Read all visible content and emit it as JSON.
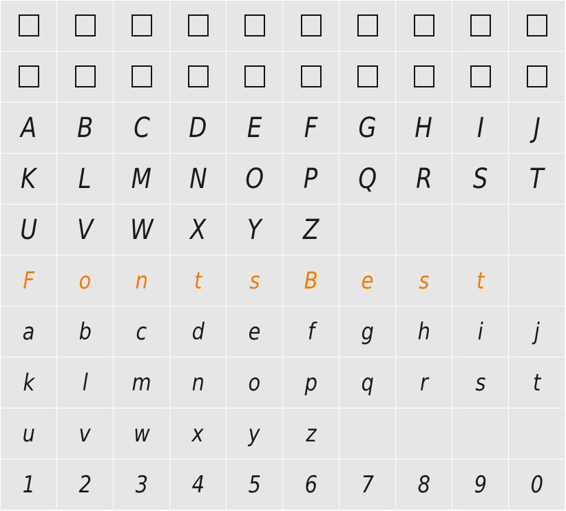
{
  "rows": [
    {
      "type": "boxes",
      "count": 10
    },
    {
      "type": "boxes",
      "count": 10
    },
    {
      "type": "upper",
      "glyphs": [
        "A",
        "B",
        "C",
        "D",
        "E",
        "F",
        "G",
        "H",
        "I",
        "J"
      ]
    },
    {
      "type": "upper",
      "glyphs": [
        "K",
        "L",
        "M",
        "N",
        "O",
        "P",
        "Q",
        "R",
        "S",
        "T"
      ]
    },
    {
      "type": "upper",
      "glyphs": [
        "U",
        "V",
        "W",
        "X",
        "Y",
        "Z",
        "",
        "",
        "",
        ""
      ]
    },
    {
      "type": "accent",
      "glyphs": [
        "F",
        "o",
        "n",
        "t",
        "s",
        "B",
        "e",
        "s",
        "t",
        ""
      ]
    },
    {
      "type": "lower",
      "glyphs": [
        "a",
        "b",
        "c",
        "d",
        "e",
        "f",
        "g",
        "h",
        "i",
        "j"
      ]
    },
    {
      "type": "lower",
      "glyphs": [
        "k",
        "l",
        "m",
        "n",
        "o",
        "p",
        "q",
        "r",
        "s",
        "t"
      ]
    },
    {
      "type": "lower",
      "glyphs": [
        "u",
        "v",
        "w",
        "x",
        "y",
        "z",
        "",
        "",
        "",
        ""
      ]
    },
    {
      "type": "lower",
      "glyphs": [
        "1",
        "2",
        "3",
        "4",
        "5",
        "6",
        "7",
        "8",
        "9",
        "0"
      ]
    }
  ],
  "colors": {
    "cell_background": "#e6e6e6",
    "grid_lines": "#ffffff",
    "glyph": "#1a1a1a",
    "accent": "#f07d00"
  },
  "icons": {
    "missing_glyph": "missing-glyph-box-icon"
  }
}
